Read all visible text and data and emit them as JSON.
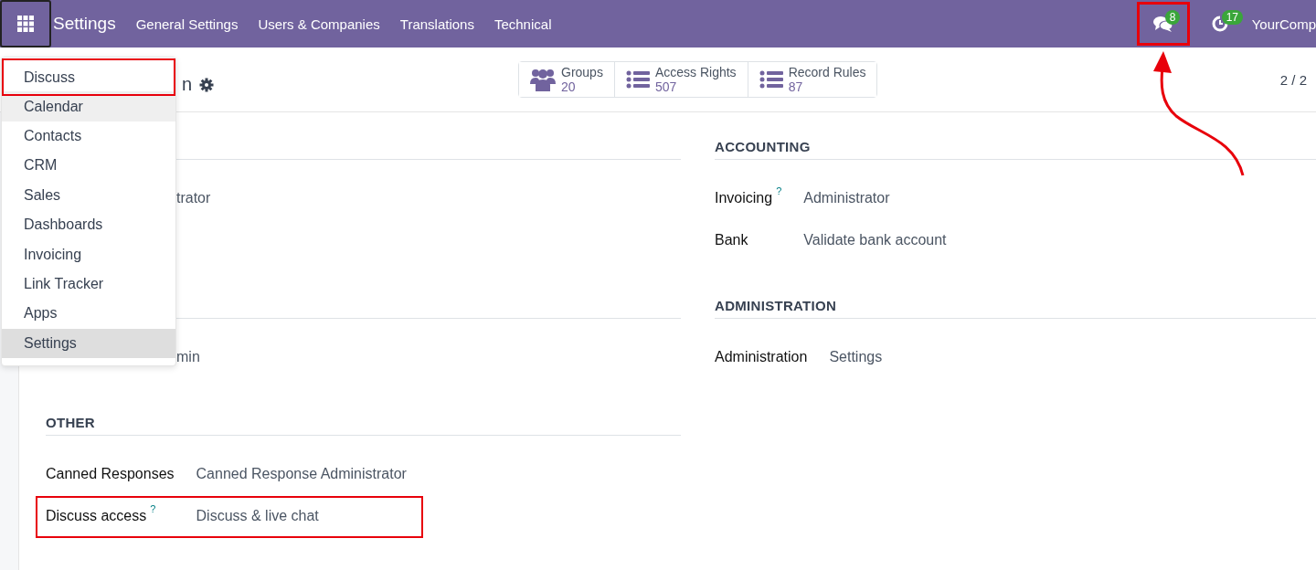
{
  "navbar": {
    "app_title": "Settings",
    "menu": [
      "General Settings",
      "Users & Companies",
      "Translations",
      "Technical"
    ],
    "messages": {
      "badge": "8",
      "highlighted": true
    },
    "activities": {
      "badge": "17"
    },
    "company": "YourComp"
  },
  "app_menu": [
    {
      "label": "Discuss",
      "selected": false,
      "focused": false,
      "highlighted": true
    },
    {
      "label": "Calendar",
      "selected": false,
      "focused": true,
      "highlighted": false
    },
    {
      "label": "Contacts",
      "selected": false,
      "focused": false,
      "highlighted": false
    },
    {
      "label": "CRM",
      "selected": false,
      "focused": false,
      "highlighted": false
    },
    {
      "label": "Sales",
      "selected": false,
      "focused": false,
      "highlighted": false
    },
    {
      "label": "Dashboards",
      "selected": false,
      "focused": false,
      "highlighted": false
    },
    {
      "label": "Invoicing",
      "selected": false,
      "focused": false,
      "highlighted": false
    },
    {
      "label": "Link Tracker",
      "selected": false,
      "focused": false,
      "highlighted": false
    },
    {
      "label": "Apps",
      "selected": false,
      "focused": false,
      "highlighted": false
    },
    {
      "label": "Settings",
      "selected": true,
      "focused": false,
      "highlighted": false
    }
  ],
  "breadcrumb": "n",
  "smart_buttons": [
    {
      "kind": "groups",
      "label": "Groups",
      "count": "20"
    },
    {
      "kind": "list",
      "label": "Access Rights",
      "count": "507"
    },
    {
      "kind": "list",
      "label": "Record Rules",
      "count": "87"
    }
  ],
  "pager": "2 / 2",
  "left_sections": [
    {
      "rows": [
        {
          "kind": "partial",
          "value": "trator"
        }
      ]
    },
    {
      "rows": [
        {
          "kind": "partial",
          "value": "min"
        }
      ]
    },
    {
      "heading": "OTHER",
      "rows": [
        {
          "kind": "field",
          "label": "Canned Responses",
          "value": "Canned Response Administrator"
        },
        {
          "kind": "field",
          "label": "Discuss access",
          "help": "?",
          "value": "Discuss & live chat",
          "highlighted": true
        }
      ]
    }
  ],
  "right_sections": [
    {
      "heading": "ACCOUNTING",
      "rows": [
        {
          "kind": "field",
          "label": "Invoicing",
          "help": "?",
          "value": "Administrator"
        },
        {
          "kind": "field",
          "label": "Bank",
          "value": "Validate bank account"
        }
      ]
    },
    {
      "heading": "ADMINISTRATION",
      "rows": [
        {
          "kind": "field",
          "label": "Administration",
          "value": "Settings"
        }
      ]
    }
  ]
}
